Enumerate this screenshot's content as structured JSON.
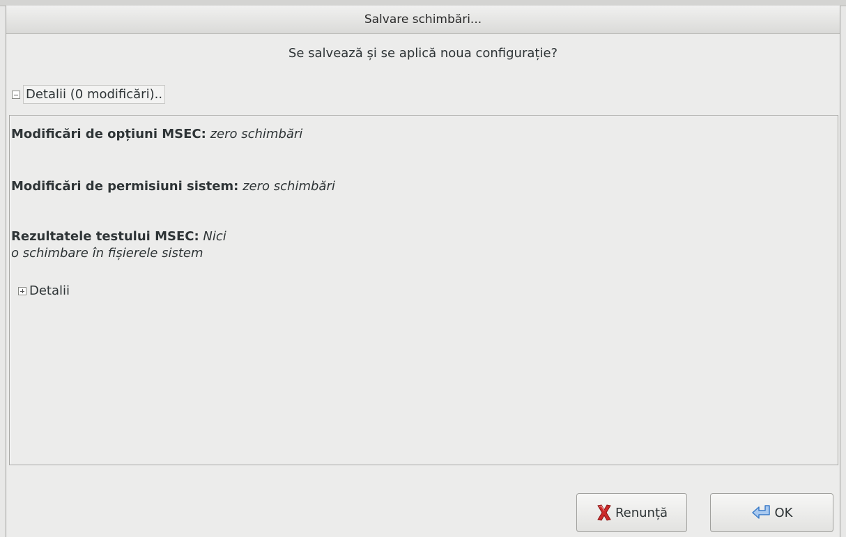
{
  "window": {
    "title": "Salvare schimbări..."
  },
  "question": "Se salvează și se aplică noua configurație?",
  "details_expander": {
    "label": "Detalii (0 modificări).."
  },
  "changes": [
    {
      "label": "Modificări de opțiuni MSEC:",
      "value": "zero schimbări"
    },
    {
      "label": "Modificări de permisiuni sistem:",
      "value": "zero schimbări"
    },
    {
      "label": "Rezultatele testului MSEC:",
      "value_line1": "Nici",
      "value_line2": "o schimbare în fișierele sistem"
    }
  ],
  "sub_expander": {
    "label": "Detalii"
  },
  "buttons": {
    "cancel": "Renunță",
    "ok": "OK"
  },
  "icons": {
    "cancel": "red-x-icon",
    "ok": "enter-arrow-icon"
  },
  "colors": {
    "cancel_icon": "#cc2a2a",
    "ok_icon": "#3a7bc8"
  }
}
